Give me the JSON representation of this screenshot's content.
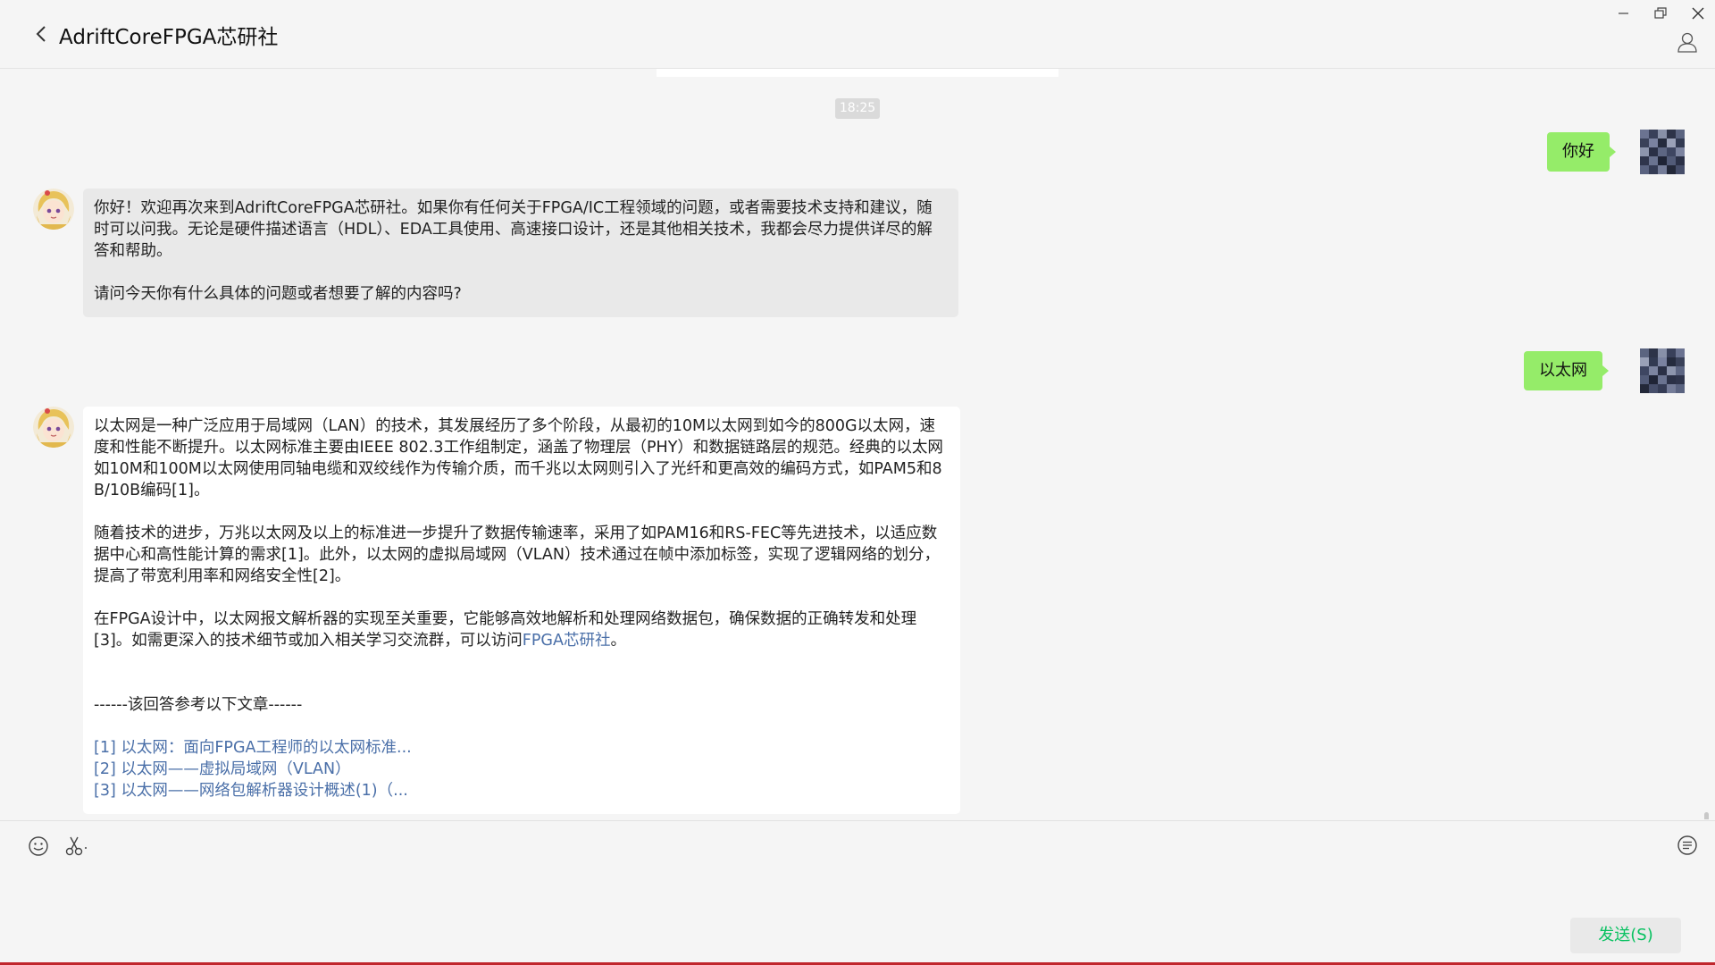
{
  "header": {
    "title": "AdriftCoreFPGA芯研社"
  },
  "messages": {
    "time_stamp": "18:25",
    "msg1_self": "你好",
    "msg2_bot": {
      "p1": "你好！欢迎再次来到AdriftCoreFPGA芯研社。如果你有任何关于FPGA/IC工程领域的问题，或者需要技术支持和建议，随时可以问我。无论是硬件描述语言（HDL）、EDA工具使用、高速接口设计，还是其他相关技术，我都会尽力提供详尽的解答和帮助。",
      "p2": "请问今天你有什么具体的问题或者想要了解的内容吗?"
    },
    "msg3_self": "以太网",
    "msg4_bot": {
      "p1": "以太网是一种广泛应用于局域网（LAN）的技术，其发展经历了多个阶段，从最初的10M以太网到如今的800G以太网，速度和性能不断提升。以太网标准主要由IEEE 802.3工作组制定，涵盖了物理层（PHY）和数据链路层的规范。经典的以太网如10M和100M以太网使用同轴电缆和双绞线作为传输介质，而千兆以太网则引入了光纤和更高效的编码方式，如PAM5和8B/10B编码[1]。",
      "p2": "随着技术的进步，万兆以太网及以上的标准进一步提升了数据传输速率，采用了如PAM16和RS-FEC等先进技术，以适应数据中心和高性能计算的需求[1]。此外，以太网的虚拟局域网（VLAN）技术通过在帧中添加标签，实现了逻辑网络的划分，提高了带宽利用率和网络安全性[2]。",
      "p3_prefix": "在FPGA设计中，以太网报文解析器的实现至关重要，它能够高效地解析和处理网络数据包，确保数据的正确转发和处理[3]。如需更深入的技术细节或加入相关学习交流群，可以访问",
      "p3_link": "FPGA芯研社",
      "p3_suffix": "。",
      "ref_header": "------该回答参考以下文章------",
      "refs": [
        "[1] 以太网：面向FPGA工程师的以太网标准...",
        "[2] 以太网——虚拟局域网（VLAN）",
        "[3] 以太网——网络包解析器设计概述(1)（..."
      ]
    }
  },
  "input": {
    "send_label": "发送(S)"
  },
  "colors": {
    "self_bubble": "#95ec69",
    "bot_bubble": "#e9e9e9",
    "link": "#4a6fa8",
    "send_text": "#07c160",
    "bottom_accent": "#c0262d"
  },
  "icons": [
    "back-icon",
    "minimize-icon",
    "restore-icon",
    "close-icon",
    "user-icon",
    "emoji-icon",
    "scissors-icon",
    "chat-history-icon"
  ]
}
